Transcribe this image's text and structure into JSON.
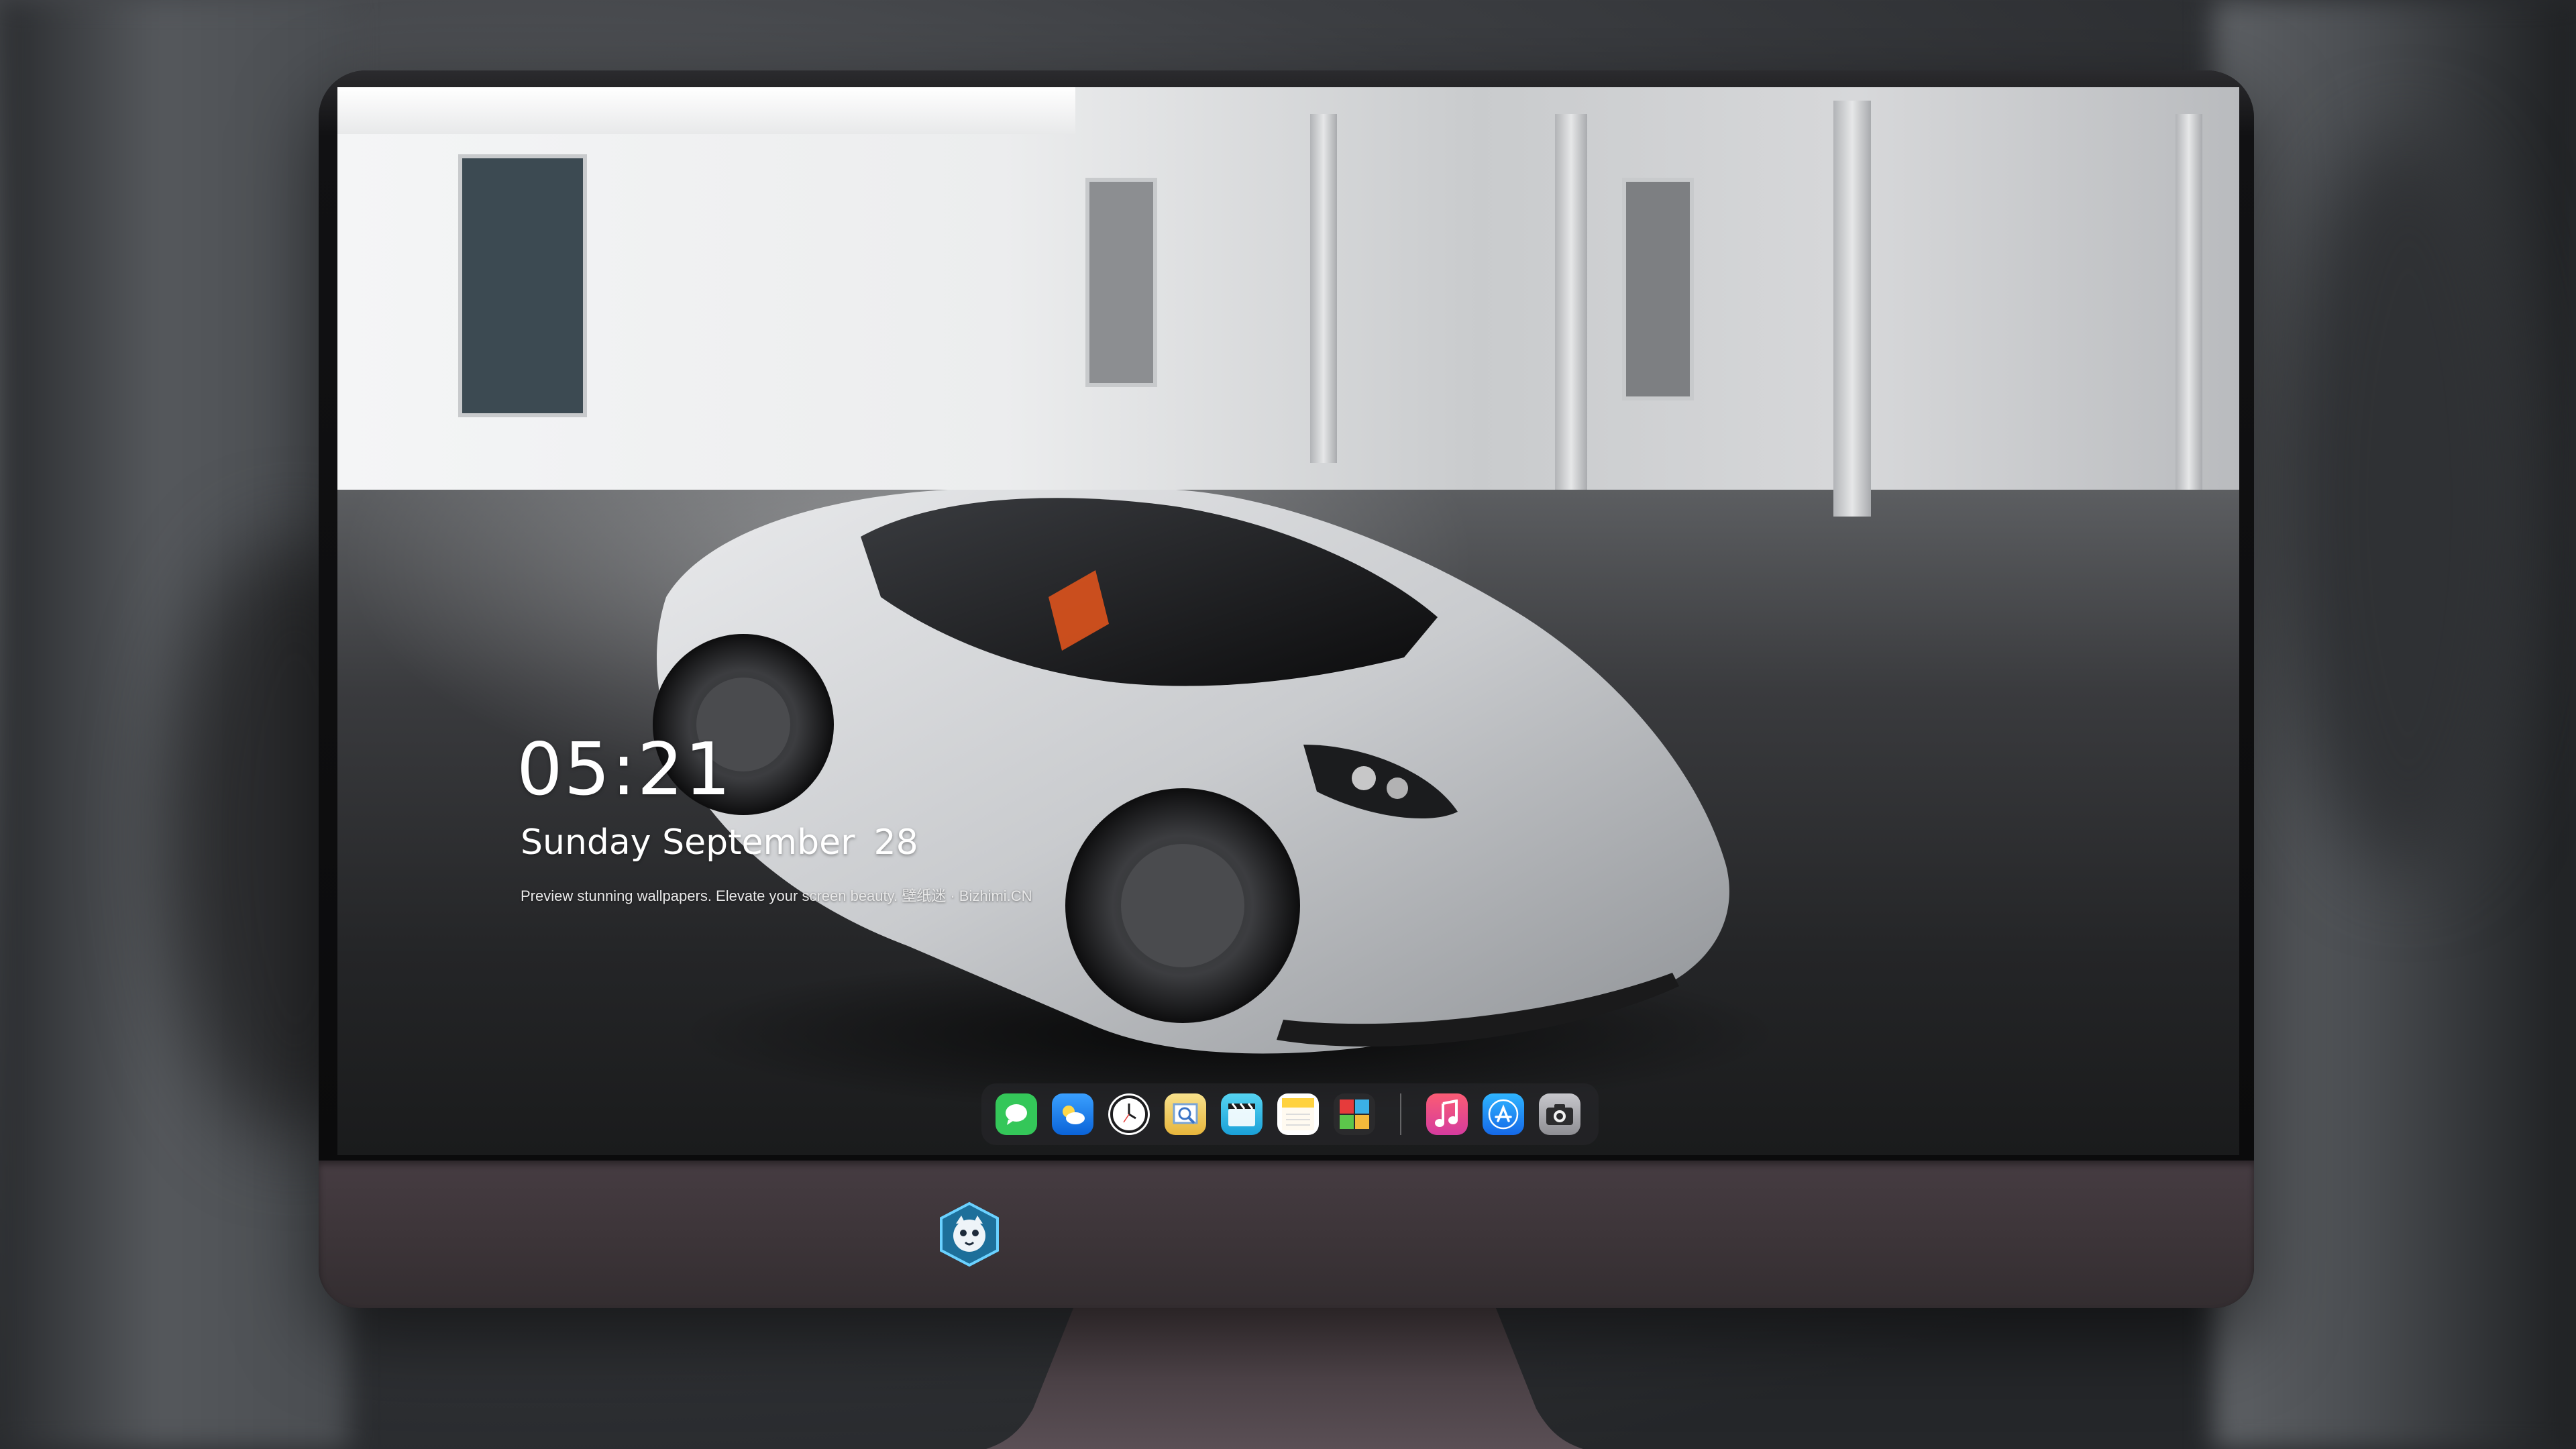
{
  "lockscreen": {
    "time": "05:21",
    "weekday": "Sunday",
    "month": "September",
    "day": "28",
    "tagline": "Preview stunning wallpapers. Elevate your screen beauty. 壁纸迷 · Bizhimi.CN"
  },
  "dock": {
    "items": [
      {
        "name": "messages",
        "icon": "messages-icon",
        "color": "#34c759"
      },
      {
        "name": "weather",
        "icon": "weather-icon",
        "color": "#1e88ff"
      },
      {
        "name": "clock",
        "icon": "clock-icon",
        "color": "#ffffff"
      },
      {
        "name": "preview",
        "icon": "preview-icon",
        "color": "#f3c64b"
      },
      {
        "name": "clips",
        "icon": "clips-icon",
        "color": "#35b6e8"
      },
      {
        "name": "notes",
        "icon": "notes-icon",
        "color": "#ffd23f"
      },
      {
        "name": "photo-booth",
        "icon": "photo-booth-icon",
        "color": "#e63b3b"
      },
      {
        "name": "music",
        "icon": "music-icon",
        "color": "#fc3c8d"
      },
      {
        "name": "app-store",
        "icon": "app-store-icon",
        "color": "#1c8cf5"
      },
      {
        "name": "screenshot",
        "icon": "camera-icon",
        "color": "#8e8e93"
      }
    ]
  },
  "chin": {
    "logo_icon": "mascot-logo-icon"
  }
}
